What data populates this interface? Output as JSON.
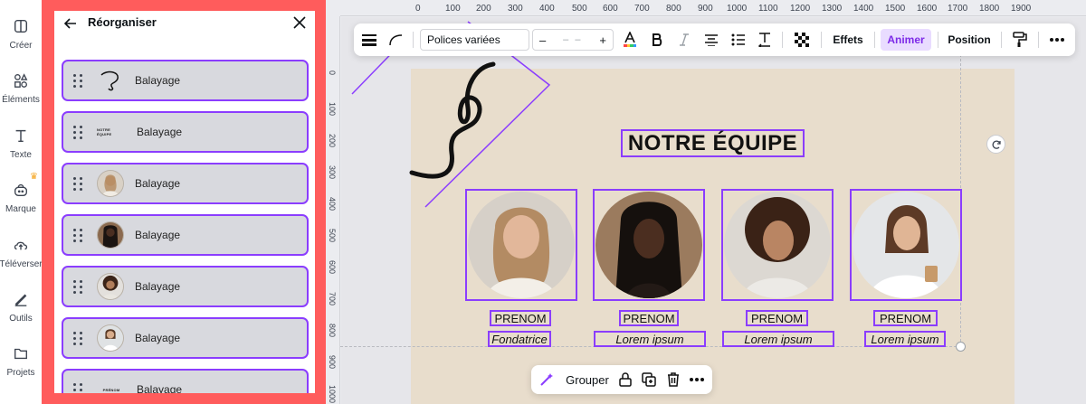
{
  "rail": {
    "items": [
      {
        "label": "Créer",
        "icon": "create-icon"
      },
      {
        "label": "Éléments",
        "icon": "elements-icon"
      },
      {
        "label": "Texte",
        "icon": "text-icon"
      },
      {
        "label": "Marque",
        "icon": "brand-icon"
      },
      {
        "label": "Téléverser",
        "icon": "upload-icon"
      },
      {
        "label": "Outils",
        "icon": "tools-icon"
      },
      {
        "label": "Projets",
        "icon": "folder-icon"
      }
    ]
  },
  "panel": {
    "title": "Réorganiser",
    "layers": [
      {
        "label": "Balayage",
        "thumb": "scribble"
      },
      {
        "label": "Balayage",
        "thumb": "text",
        "thumb_text": "NOTRE ÉQUIPE"
      },
      {
        "label": "Balayage",
        "thumb": "photo"
      },
      {
        "label": "Balayage",
        "thumb": "photo"
      },
      {
        "label": "Balayage",
        "thumb": "photo"
      },
      {
        "label": "Balayage",
        "thumb": "photo"
      },
      {
        "label": "Balayage",
        "thumb": "text",
        "thumb_text": "PRÉNOM"
      }
    ]
  },
  "ruler": {
    "top": [
      "0",
      "100",
      "200",
      "300",
      "400",
      "500",
      "600",
      "700",
      "800",
      "900",
      "1000",
      "1100",
      "1200",
      "1300",
      "1400",
      "1500",
      "1600",
      "1700",
      "1800",
      "1900"
    ],
    "left": [
      "0",
      "100",
      "200",
      "300",
      "400",
      "500",
      "600",
      "700",
      "800",
      "900",
      "1000"
    ]
  },
  "toolbar": {
    "font": "Polices variées",
    "size_minus": "–",
    "size_value": "– –",
    "size_plus": "+",
    "effects": "Effets",
    "animate": "Animer",
    "position": "Position"
  },
  "design": {
    "title": "NOTRE ÉQUIPE",
    "members": [
      {
        "name": "PRENOM",
        "role": "Fondatrice"
      },
      {
        "name": "PRENOM",
        "role": "Lorem ipsum"
      },
      {
        "name": "PRENOM",
        "role": "Lorem ipsum"
      },
      {
        "name": "PRENOM",
        "role": "Lorem ipsum"
      }
    ]
  },
  "groupbar": {
    "group": "Grouper"
  },
  "colors": {
    "accent": "#8b3dff",
    "panel_frame": "#ff5c5c",
    "design_bg": "#e8ddcc"
  }
}
